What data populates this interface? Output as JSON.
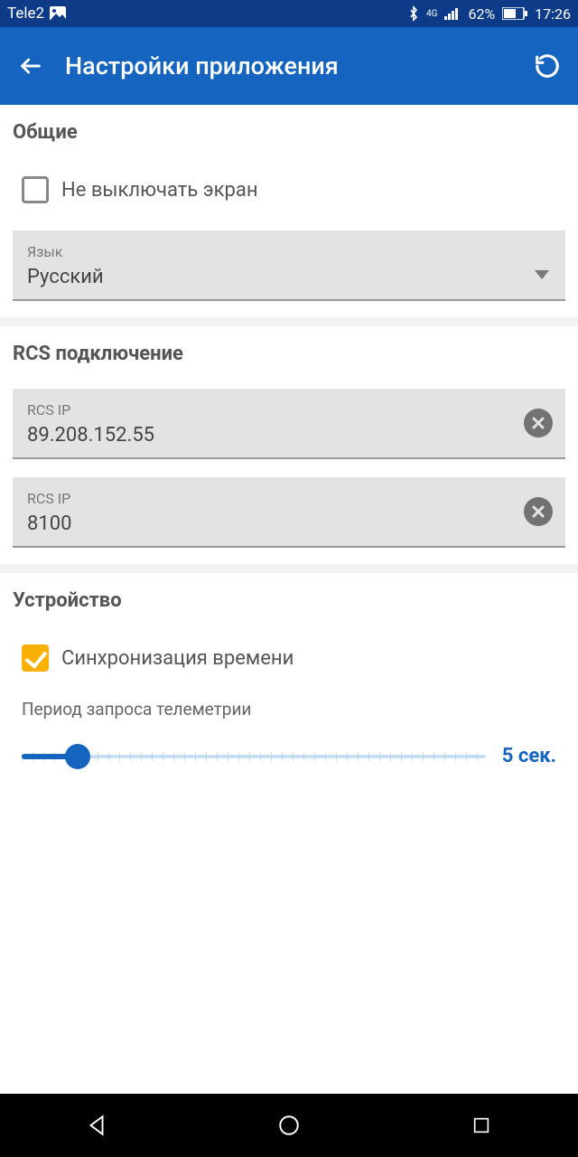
{
  "statusbar": {
    "carrier": "Tele2",
    "battery": "62%",
    "time": "17:26"
  },
  "appbar": {
    "title": "Настройки приложения"
  },
  "section_general": {
    "title": "Общие",
    "keep_screen_label": "Не выключать экран",
    "language_label": "Язык",
    "language_value": "Русский"
  },
  "section_rcs": {
    "title": "RCS подключение",
    "ip_label": "RCS IP",
    "ip_value": "89.208.152.55",
    "port_label": "RCS IP",
    "port_value": "8100"
  },
  "section_device": {
    "title": "Устройство",
    "time_sync_label": "Синхронизация времени",
    "telemetry_caption": "Период запроса телеметрии",
    "telemetry_value": "5 сек.",
    "slider_percent": 12
  }
}
